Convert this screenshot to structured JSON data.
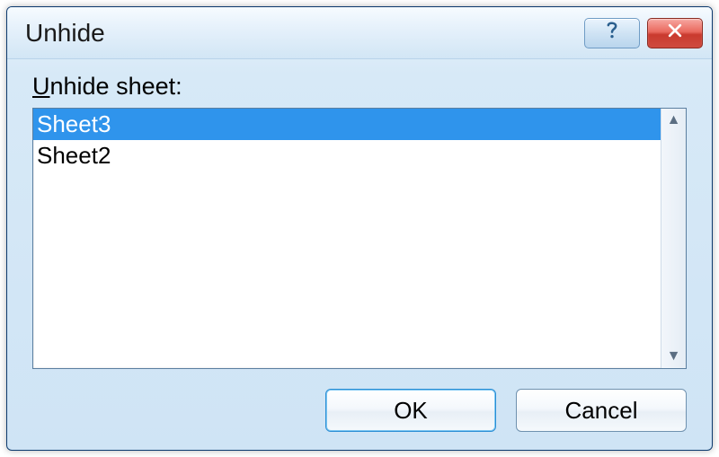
{
  "dialog": {
    "title": "Unhide",
    "label_prefix": "U",
    "label_rest": "nhide sheet:"
  },
  "list": {
    "items": [
      {
        "label": "Sheet3",
        "selected": true
      },
      {
        "label": "Sheet2",
        "selected": false
      }
    ]
  },
  "buttons": {
    "ok": "OK",
    "cancel": "Cancel"
  },
  "icons": {
    "help": "help-icon",
    "close": "close-icon",
    "scroll_up": "▲",
    "scroll_down": "▼"
  }
}
